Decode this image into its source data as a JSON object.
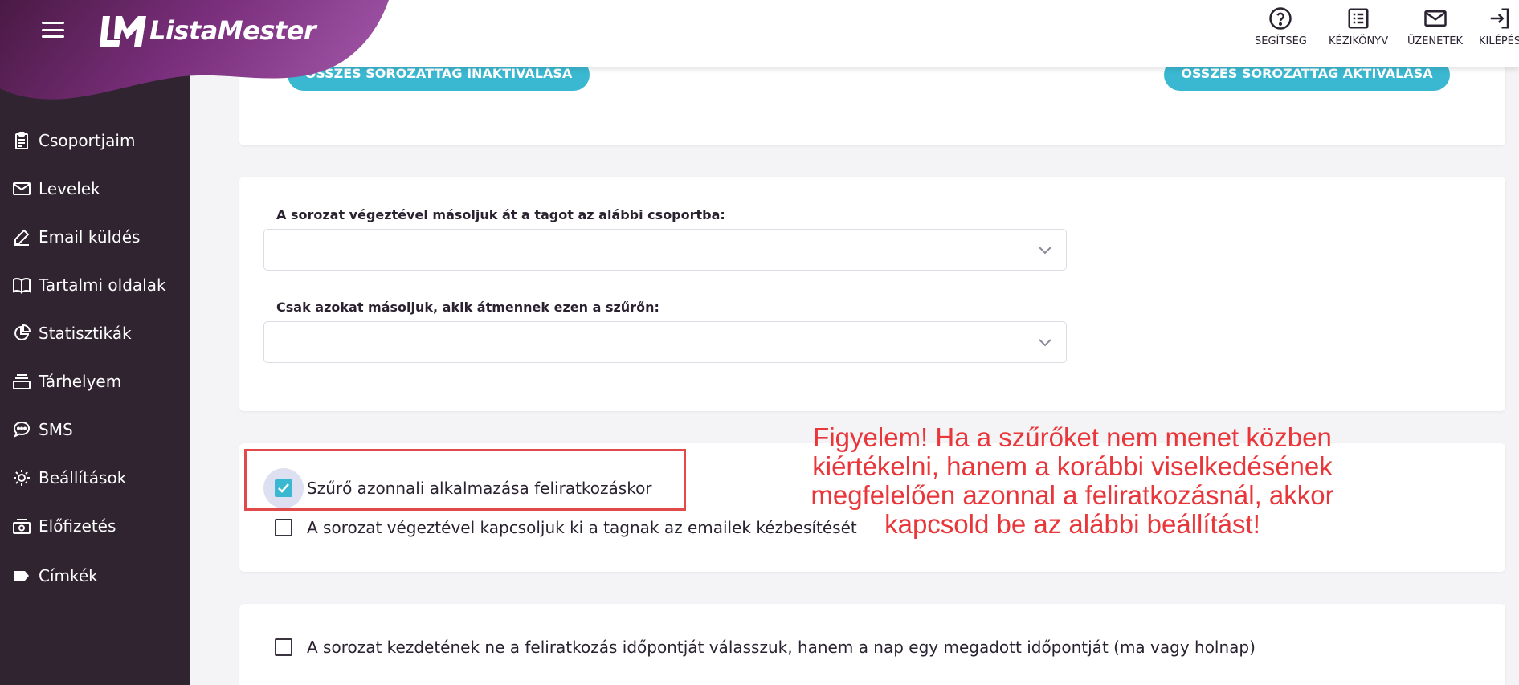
{
  "app": {
    "brand": "ListaMester",
    "brand_color": "#7a2f7c",
    "accent": "#3bb8d1",
    "sidebar_bg": "#2f2430"
  },
  "topbar": {
    "actions": [
      {
        "label": "SEGÍTSÉG",
        "icon": "help-circle-icon"
      },
      {
        "label": "KÉZIKÖNYV",
        "icon": "manual-list-icon"
      },
      {
        "label": "ÜZENETEK",
        "icon": "mail-icon"
      },
      {
        "label": "KILÉPÉS",
        "icon": "logout-icon"
      }
    ]
  },
  "sidebar": {
    "items": [
      {
        "label": "Csoportjaim",
        "icon": "clipboard-icon"
      },
      {
        "label": "Levelek",
        "icon": "mail-icon"
      },
      {
        "label": "Email küldés",
        "icon": "pencil-icon"
      },
      {
        "label": "Tartalmi oldalak",
        "icon": "book-icon"
      },
      {
        "label": "Statisztikák",
        "icon": "pie-chart-icon"
      },
      {
        "label": "Tárhelyem",
        "icon": "storage-icon"
      },
      {
        "label": "SMS",
        "icon": "chat-bubble-icon"
      },
      {
        "label": "Beállítások",
        "icon": "gear-icon"
      },
      {
        "label": "Előfizetés",
        "icon": "payment-icon"
      },
      {
        "label": "Címkék",
        "icon": "tag-icon"
      }
    ]
  },
  "series_members": {
    "deactivate_all": "ÖSSZES SOROZATTAG INAKTIVÁLÁSA",
    "activate_all": "ÖSSZES SOROZATTAG AKTIVÁLÁSA"
  },
  "copy_settings": {
    "copy_group_label": "A sorozat végeztével másoljuk át a tagot az alábbi csoportba:",
    "copy_group_value": "",
    "filter_label": "Csak azokat másoljuk, akik átmennek ezen a szűrőn:",
    "filter_value": ""
  },
  "options": {
    "apply_filter_on_subscribe": {
      "label": "Szűrő azonnali alkalmazása feliratkozáskor",
      "checked": true
    },
    "disable_email_after_series": {
      "label": "A sorozat végeztével kapcsoljuk ki a tagnak az emailek kézbesítését",
      "checked": false
    },
    "start_at_fixed_time": {
      "label": "A sorozat kezdetének ne a feliratkozás időpontját válasszuk, hanem a nap egy megadott időpontját (ma vagy holnap)",
      "checked": false
    }
  },
  "annotation": {
    "text": "Figyelem! Ha a szűrőket nem menet közben kiértékelni, hanem a korábbi viselkedésének megfelelően azonnal a feliratkozásnál, akkor kapcsold be az alábbi beállítást!",
    "color": "#e8363a"
  }
}
